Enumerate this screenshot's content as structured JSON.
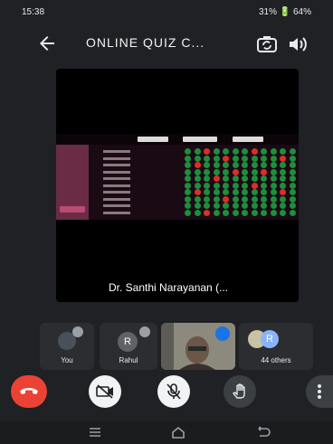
{
  "status_bar": {
    "time": "15:38",
    "right": "31% 🔋 64%"
  },
  "header": {
    "title": "ONLINE QUIZ C...",
    "back_icon": "arrow-left-icon",
    "flip_camera_icon": "flip-camera-icon",
    "speaker_icon": "speaker-icon"
  },
  "stage": {
    "presenter_name": "Dr. Santhi Narayanan (..."
  },
  "participants": [
    {
      "label": "You"
    },
    {
      "label": "Rahul",
      "initial": "R"
    },
    {
      "label": ""
    },
    {
      "label": "44 others",
      "initial": "R"
    }
  ],
  "controls": {
    "end_call_icon": "end-call-icon",
    "camera_icon": "camera-off-icon",
    "mic_icon": "mic-off-icon",
    "hand_icon": "raise-hand-icon",
    "more_icon": "more-vertical-icon"
  },
  "nav": {
    "items": [
      "menu-icon",
      "home-icon",
      "back-icon"
    ]
  },
  "colors": {
    "background": "#1f2124",
    "end_call": "#ea4335",
    "accent_blue": "#1a73e8",
    "rahul_avatar": "#5f6368",
    "others_avatar": "#8ab4f8"
  }
}
